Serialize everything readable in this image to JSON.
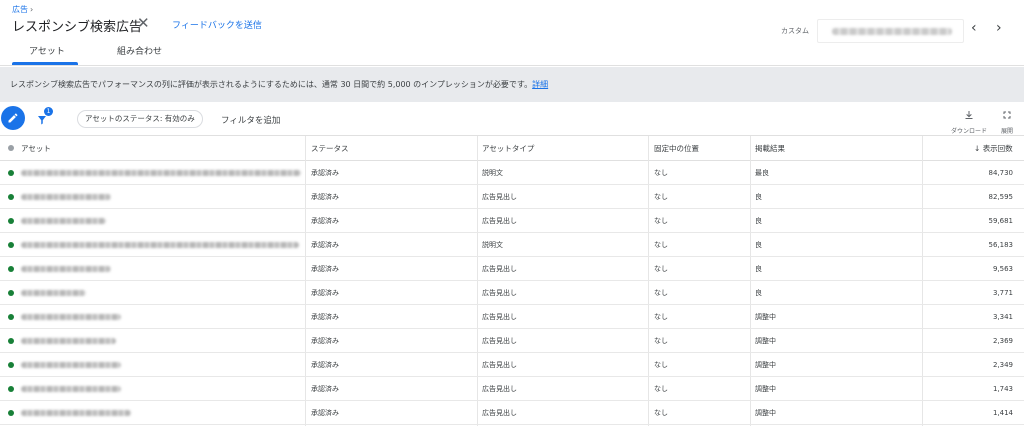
{
  "header": {
    "breadcrumb": "広告",
    "title": "レスポンシブ検索広告",
    "feedback": "フィードバックを送信",
    "custom_label": "カスタム"
  },
  "tabs": [
    {
      "label": "アセット"
    },
    {
      "label": "組み合わせ"
    }
  ],
  "banner": {
    "text": "レスポンシブ検索広告でパフォーマンスの列に評価が表示されるようにするためには、通常 30 日間で約 5,000 のインプレッションが必要です。",
    "link": "詳細"
  },
  "toolbar": {
    "filter_count": "1",
    "chip": "アセットのステータス: 有効のみ",
    "add_filter": "フィルタを追加",
    "download": "ダウンロード",
    "expand": "展開"
  },
  "table": {
    "headers": {
      "asset": "アセット",
      "status": "ステータス",
      "type": "アセットタイプ",
      "pinned": "固定中の位置",
      "performance": "掲載結果",
      "impressions": "表示回数"
    },
    "rows": [
      {
        "status": "承認済み",
        "type": "説明文",
        "pinned": "なし",
        "performance": "最良",
        "impressions": "84,730"
      },
      {
        "status": "承認済み",
        "type": "広告見出し",
        "pinned": "なし",
        "performance": "良",
        "impressions": "82,595"
      },
      {
        "status": "承認済み",
        "type": "広告見出し",
        "pinned": "なし",
        "performance": "良",
        "impressions": "59,681"
      },
      {
        "status": "承認済み",
        "type": "説明文",
        "pinned": "なし",
        "performance": "良",
        "impressions": "56,183"
      },
      {
        "status": "承認済み",
        "type": "広告見出し",
        "pinned": "なし",
        "performance": "良",
        "impressions": "9,563"
      },
      {
        "status": "承認済み",
        "type": "広告見出し",
        "pinned": "なし",
        "performance": "良",
        "impressions": "3,771"
      },
      {
        "status": "承認済み",
        "type": "広告見出し",
        "pinned": "なし",
        "performance": "調整中",
        "impressions": "3,341"
      },
      {
        "status": "承認済み",
        "type": "広告見出し",
        "pinned": "なし",
        "performance": "調整中",
        "impressions": "2,369"
      },
      {
        "status": "承認済み",
        "type": "広告見出し",
        "pinned": "なし",
        "performance": "調整中",
        "impressions": "2,349"
      },
      {
        "status": "承認済み",
        "type": "広告見出し",
        "pinned": "なし",
        "performance": "調整中",
        "impressions": "1,743"
      },
      {
        "status": "承認済み",
        "type": "広告見出し",
        "pinned": "なし",
        "performance": "調整中",
        "impressions": "1,414"
      }
    ]
  },
  "colors": {
    "accent": "#1a73e8",
    "status_dot": "#188038",
    "banner_bg": "#e8eaed"
  }
}
